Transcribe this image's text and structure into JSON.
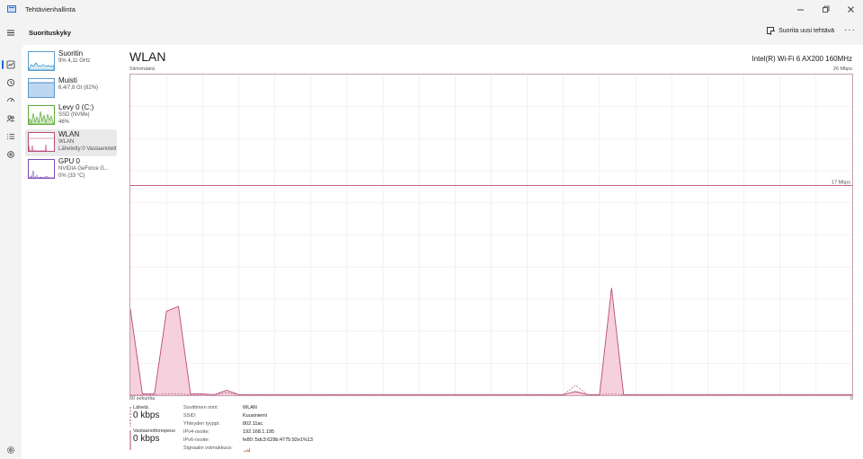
{
  "window": {
    "title": "Tehtävienhallinta"
  },
  "header": {
    "page_heading": "Suorituskyky",
    "run_task_label": "Suorita uusi tehtävä",
    "more_label": "···"
  },
  "resources": [
    {
      "name": "Suoritin",
      "sub1": "9% 4,11 GHz",
      "sub2": "",
      "sub3": ""
    },
    {
      "name": "Muisti",
      "sub1": "6,4/7,8 Gt (82%)",
      "sub2": "",
      "sub3": ""
    },
    {
      "name": "Levy 0 (C:)",
      "sub1": "SSD (NVMe)",
      "sub2": "46%",
      "sub3": ""
    },
    {
      "name": "WLAN",
      "sub1": "WLAN",
      "sub2": "Lähetetty:0 Vastaanotett",
      "sub3": ""
    },
    {
      "name": "GPU 0",
      "sub1": "NVIDIA GeForce G...",
      "sub2": "0% (33 °C)",
      "sub3": ""
    }
  ],
  "detail": {
    "title": "WLAN",
    "adapter": "Intel(R) Wi-Fi 6 AX200 160MHz",
    "throughput_label": "Siirtomäärä",
    "max_label": "26 Mbps",
    "mid_label": "17 Mbps",
    "time_label": "60 sekuntia",
    "zero_label": "0"
  },
  "stats": {
    "send_label": "Lähetä",
    "send_value": "0 kbps",
    "recv_label": "Vastaanottonopeus",
    "recv_value": "0 kbps",
    "props": [
      {
        "key": "Sovittimen nimi:",
        "value": "WLAN"
      },
      {
        "key": "SSID:",
        "value": "Kuusiniemi"
      },
      {
        "key": "Yhteyden tyyppi:",
        "value": "802.11ac"
      },
      {
        "key": "IPv4-osoite:",
        "value": "192.168.1.195"
      },
      {
        "key": "IPv6-osoite:",
        "value": "fe80::5dc3:629b:4775:92e1%13"
      },
      {
        "key": "Signaalin voimakkuus:",
        "value": ""
      }
    ]
  },
  "colors": {
    "accent": "#1a6ad6",
    "net": "#b84a7a",
    "net_fill": "#f6d0dd",
    "cpu": "#1f8fc9",
    "disk": "#4aa02c",
    "gpu": "#7a4ab8"
  },
  "chart_data": {
    "type": "area",
    "title": "",
    "xlabel": "60 sekuntia",
    "ylabel": "Siirtomäärä",
    "xlim": [
      60,
      0
    ],
    "ylim": [
      0,
      26
    ],
    "y_unit": "Mbps",
    "x": [
      60,
      59,
      58,
      57,
      56,
      55,
      54,
      53,
      52,
      51,
      50,
      49,
      48,
      47,
      46,
      45,
      44,
      43,
      42,
      41,
      40,
      39,
      38,
      37,
      36,
      35,
      34,
      33,
      32,
      31,
      30,
      29,
      28,
      27,
      26,
      25,
      24,
      23,
      22,
      21,
      20,
      19,
      18,
      17,
      16,
      15,
      14,
      13,
      12,
      11,
      10,
      9,
      8,
      7,
      6,
      5,
      4,
      3,
      2,
      1,
      0
    ],
    "series": [
      {
        "name": "Vastaanottonopeus",
        "values": [
          7.0,
          0.1,
          0.1,
          6.8,
          7.2,
          0.1,
          0.1,
          0.05,
          0.4,
          0.05,
          0.05,
          0.05,
          0.05,
          0.05,
          0.05,
          0.05,
          0.05,
          0.05,
          0.05,
          0.05,
          0.05,
          0.05,
          0.05,
          0.05,
          0.05,
          0.05,
          0.05,
          0.05,
          0.05,
          0.05,
          0.05,
          0.05,
          0.05,
          0.05,
          0.05,
          0.05,
          0.05,
          0.3,
          0.05,
          0.05,
          8.7,
          0.05,
          0.05,
          0.05,
          0.05,
          0.05,
          0.05,
          0.05,
          0.05,
          0.05,
          0.05,
          0.05,
          0.05,
          0.05,
          0.05,
          0.05,
          0.05,
          0.05,
          0.05,
          0.05,
          0.05
        ]
      },
      {
        "name": "Lähetä",
        "values": [
          0.05,
          0.05,
          0.05,
          0.1,
          0.1,
          0.05,
          0.05,
          0.05,
          0.2,
          0.05,
          0.05,
          0.05,
          0.05,
          0.05,
          0.05,
          0.05,
          0.05,
          0.05,
          0.05,
          0.05,
          0.05,
          0.05,
          0.05,
          0.05,
          0.05,
          0.05,
          0.05,
          0.05,
          0.05,
          0.05,
          0.05,
          0.05,
          0.05,
          0.05,
          0.05,
          0.05,
          0.05,
          0.8,
          0.05,
          0.05,
          0.1,
          0.05,
          0.05,
          0.05,
          0.05,
          0.05,
          0.05,
          0.05,
          0.05,
          0.05,
          0.05,
          0.05,
          0.05,
          0.05,
          0.05,
          0.05,
          0.05,
          0.05,
          0.05,
          0.05,
          0.05
        ]
      }
    ],
    "reference_lines": [
      {
        "label": "17 Mbps",
        "value": 17
      }
    ],
    "grid": true,
    "legend": "none"
  }
}
